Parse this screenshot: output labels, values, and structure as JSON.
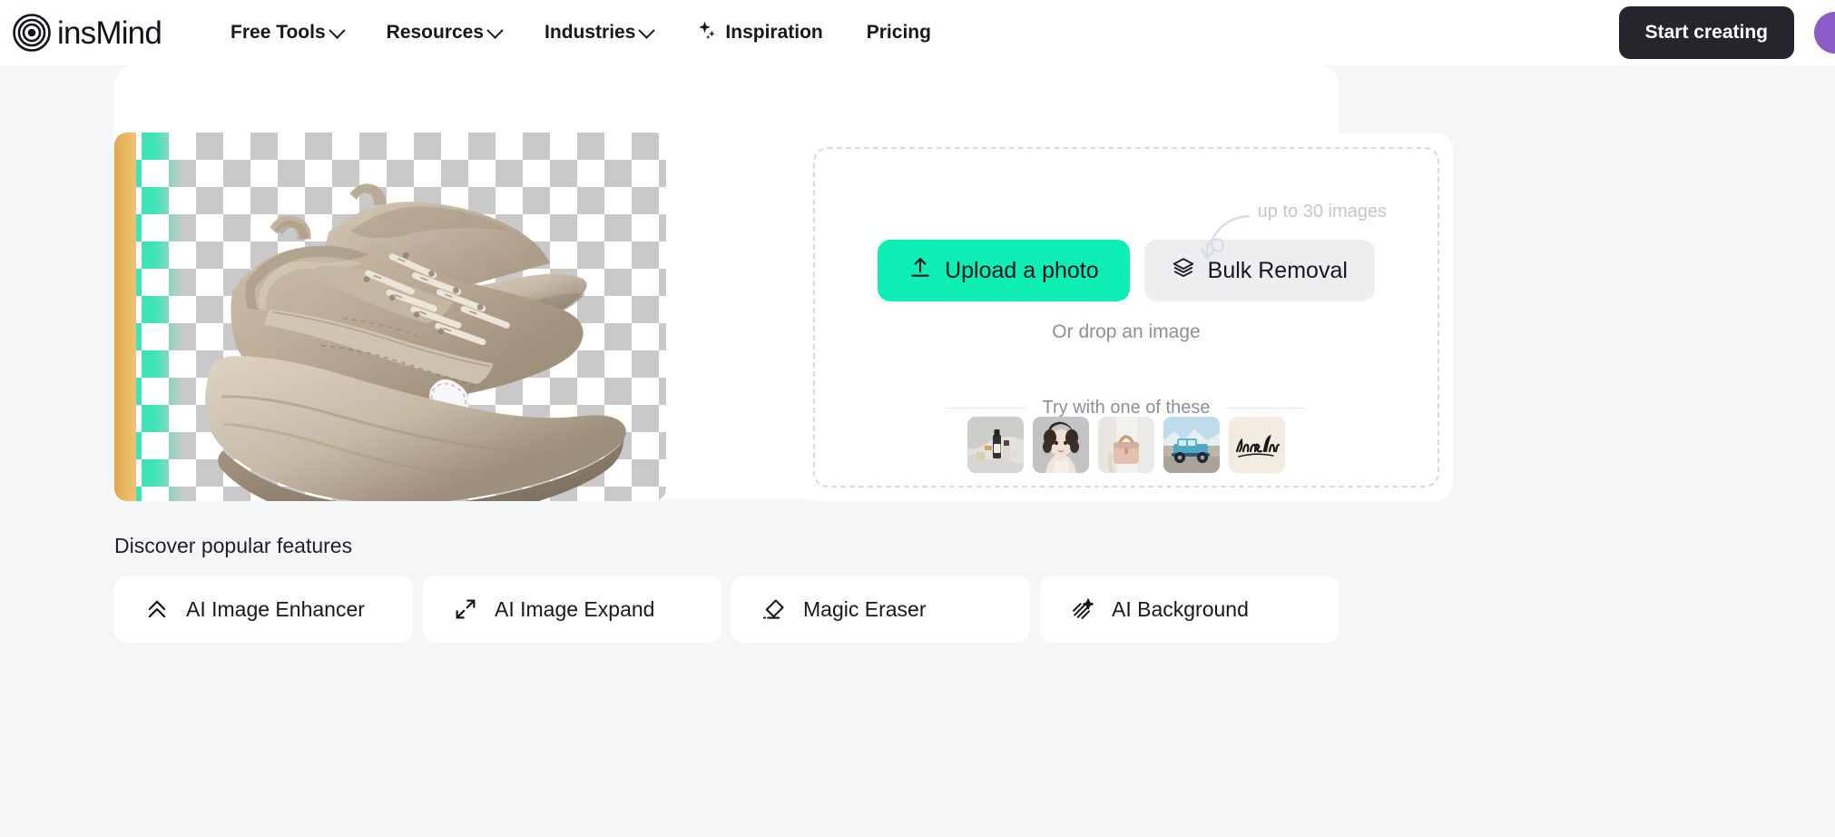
{
  "brand": {
    "name": "insMind",
    "logo_icon": "concentric-rings-icon",
    "accent_teal": "#0ceeb4",
    "accent_dark": "#24262b",
    "avatar_color": "#8b5cc7"
  },
  "header": {
    "nav": [
      {
        "label": "Free Tools",
        "icon": "chevron-down-icon",
        "has_caret": true,
        "has_sparkle": false
      },
      {
        "label": "Resources",
        "icon": "chevron-down-icon",
        "has_caret": true,
        "has_sparkle": false
      },
      {
        "label": "Industries",
        "icon": "chevron-down-icon",
        "has_caret": true,
        "has_sparkle": false
      },
      {
        "label": "Inspiration",
        "icon": "sparkle-icon",
        "has_caret": false,
        "has_sparkle": true
      },
      {
        "label": "Pricing",
        "icon": "",
        "has_caret": false,
        "has_sparkle": false
      }
    ],
    "start_button": "Start creating",
    "avatar_icon": "user-avatar"
  },
  "preview": {
    "icon": "sneaker-image",
    "description": "Beige chunky sneakers on transparent checkerboard with before/after reveal slider",
    "original_background_color": "#e9b962",
    "reveal_tint_color": "#2ee2b2",
    "checker_color": "#c9c9c9"
  },
  "upload": {
    "upload_button": "Upload a photo",
    "upload_icon": "upload-arrow-icon",
    "bulk_button": "Bulk Removal",
    "bulk_icon": "layers-icon",
    "drop_text": "Or drop an image",
    "hint_text": "up to 30 images",
    "hint_arrow_icon": "curved-arrow-icon",
    "try_label": "Try with one of these",
    "samples": [
      {
        "name": "cosmetics-bottles-thumbnail"
      },
      {
        "name": "woman-portrait-thumbnail"
      },
      {
        "name": "pink-handbag-thumbnail"
      },
      {
        "name": "blue-truck-thumbnail"
      },
      {
        "name": "insmind-signature-thumbnail"
      }
    ]
  },
  "features": {
    "title": "Discover popular features",
    "items": [
      {
        "label": "AI Image Enhancer",
        "icon": "double-chevron-up-icon"
      },
      {
        "label": "AI Image Expand",
        "icon": "expand-arrows-icon"
      },
      {
        "label": "Magic Eraser",
        "icon": "eraser-icon"
      },
      {
        "label": "AI Background",
        "icon": "hatch-sparkle-icon"
      }
    ]
  }
}
